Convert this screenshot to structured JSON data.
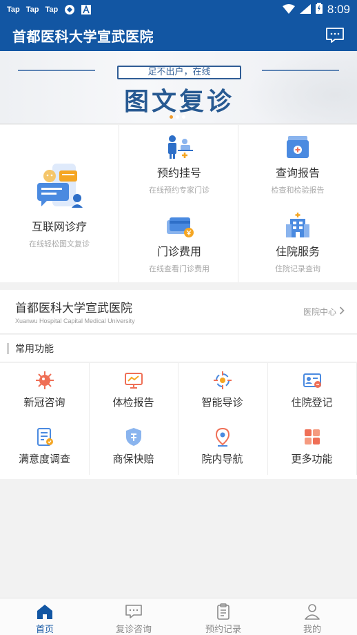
{
  "status_bar": {
    "apps": [
      "Tap",
      "Tap",
      "Tap"
    ],
    "time": "8:09"
  },
  "header": {
    "title": "首都医科大学宣武医院",
    "message_icon": "chat-bubble-icon"
  },
  "banner": {
    "subtitle": "足不出户，在线",
    "headline": "图文复诊",
    "slide_count": 3,
    "active_slide": 1
  },
  "services": {
    "main": {
      "name": "互联网诊疗",
      "desc": "在线轻松图文复诊",
      "icon": "chat-phone-icon"
    },
    "items": [
      {
        "name": "预约挂号",
        "desc": "在线预约专家门诊",
        "icon": "doctor-appointment-icon"
      },
      {
        "name": "查询报告",
        "desc": "检查和检验报告",
        "icon": "report-folder-icon"
      },
      {
        "name": "门诊费用",
        "desc": "在线查看门诊费用",
        "icon": "payment-card-icon"
      },
      {
        "name": "住院服务",
        "desc": "住院记录查询",
        "icon": "hospital-building-icon"
      }
    ]
  },
  "hospital": {
    "name": "首都医科大学宣武医院",
    "name_en": "Xuanwu Hospital Capital Medical University",
    "center_link": "医院中心"
  },
  "common": {
    "label": "常用功能",
    "items": [
      {
        "label": "新冠咨询",
        "icon": "virus-icon"
      },
      {
        "label": "体检报告",
        "icon": "monitor-chart-icon"
      },
      {
        "label": "智能导诊",
        "icon": "crosshair-icon"
      },
      {
        "label": "住院登记",
        "icon": "id-card-icon"
      },
      {
        "label": "满意度调查",
        "icon": "survey-icon"
      },
      {
        "label": "商保快赔",
        "icon": "insurance-shield-icon"
      },
      {
        "label": "院内导航",
        "icon": "map-pin-icon"
      },
      {
        "label": "更多功能",
        "icon": "grid-more-icon"
      }
    ]
  },
  "bottom_nav": {
    "items": [
      {
        "label": "首页",
        "icon": "home-icon",
        "active": true
      },
      {
        "label": "复诊咨询",
        "icon": "chat-icon",
        "active": false
      },
      {
        "label": "预约记录",
        "icon": "clipboard-icon",
        "active": false
      },
      {
        "label": "我的",
        "icon": "user-icon",
        "active": false
      }
    ]
  },
  "colors": {
    "primary": "#1256a3",
    "accent_orange": "#f5a623",
    "icon_blue": "#4a8ae0",
    "icon_red": "#ef6f56"
  }
}
